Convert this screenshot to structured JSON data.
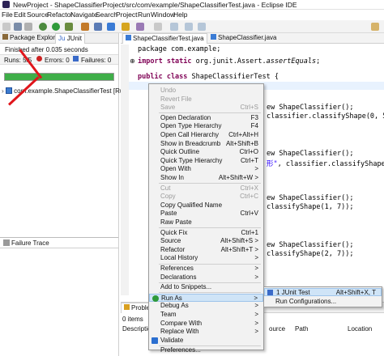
{
  "window": {
    "title": "NewProject - ShapeClassifierProject/src/com/example/ShapeClassifierTest.java - Eclipse IDE"
  },
  "menubar": [
    "File",
    "Edit",
    "Source",
    "Refactor",
    "Navigate",
    "Search",
    "Project",
    "Run",
    "Window",
    "Help"
  ],
  "left_tabs": {
    "package_explorer": "Package Explorer",
    "junit": "JUnit"
  },
  "junit": {
    "finished": "Finished after 0.035 seconds",
    "runs": "Runs: 5/5",
    "errors": "Errors: 0",
    "failures": "Failures: 0",
    "test_node": "com.example.ShapeClassifierTest [Runne",
    "bar_color": "#3fae49"
  },
  "failure_trace": {
    "label": "Failure Trace"
  },
  "editor": {
    "tabs": [
      "ShapeClassifierTest.java",
      "ShapeClassifier.java"
    ],
    "line1": "package com.example;",
    "line2_kw": "import static",
    "line2_rest": " org.junit.Assert.",
    "line2_it": "assertEquals",
    "line2_end": ";",
    "line3_kw": "public class",
    "line3_rest": " ShapeClassifierTest {",
    "frag1": "ew ShapeClassifier();",
    "frag2": "classifier.classifyShape(0, 5",
    "frag3": "ew ShapeClassifier();",
    "frag4_str": "形\"",
    "frag4_rest": ", classifier.classifyShape(",
    "frag5": "ew ShapeClassifier();",
    "frag6": "classifyShape(1, 7));",
    "frag7": "ew ShapeClassifier();",
    "frag8": "classifyShape(2, 7));",
    "frag9": "ource",
    "frag10": "Path",
    "frag11": "Location"
  },
  "context_menu": [
    {
      "label": "Undo",
      "shortcut": "",
      "disabled": true,
      "sep_after": false
    },
    {
      "label": "Revert File",
      "shortcut": "",
      "disabled": true,
      "sep_after": false
    },
    {
      "label": "Save",
      "shortcut": "Ctrl+S",
      "disabled": true,
      "sep_after": true
    },
    {
      "label": "Open Declaration",
      "shortcut": "F3",
      "disabled": false,
      "sep_after": false
    },
    {
      "label": "Open Type Hierarchy",
      "shortcut": "F4",
      "disabled": false,
      "sep_after": false
    },
    {
      "label": "Open Call Hierarchy",
      "shortcut": "Ctrl+Alt+H",
      "disabled": false,
      "sep_after": false
    },
    {
      "label": "Show in Breadcrumb",
      "shortcut": "Alt+Shift+B",
      "disabled": false,
      "sep_after": false
    },
    {
      "label": "Quick Outline",
      "shortcut": "Ctrl+O",
      "disabled": false,
      "sep_after": false
    },
    {
      "label": "Quick Type Hierarchy",
      "shortcut": "Ctrl+T",
      "disabled": false,
      "sep_after": false
    },
    {
      "label": "Open With",
      "shortcut": ">",
      "disabled": false,
      "sep_after": false
    },
    {
      "label": "Show In",
      "shortcut": "Alt+Shift+W >",
      "disabled": false,
      "sep_after": true
    },
    {
      "label": "Cut",
      "shortcut": "Ctrl+X",
      "disabled": true,
      "sep_after": false
    },
    {
      "label": "Copy",
      "shortcut": "Ctrl+C",
      "disabled": true,
      "sep_after": false
    },
    {
      "label": "Copy Qualified Name",
      "shortcut": "",
      "disabled": false,
      "sep_after": false
    },
    {
      "label": "Paste",
      "shortcut": "Ctrl+V",
      "disabled": false,
      "sep_after": false
    },
    {
      "label": "Raw Paste",
      "shortcut": "",
      "disabled": false,
      "sep_after": true
    },
    {
      "label": "Quick Fix",
      "shortcut": "Ctrl+1",
      "disabled": false,
      "sep_after": false
    },
    {
      "label": "Source",
      "shortcut": "Alt+Shift+S >",
      "disabled": false,
      "sep_after": false
    },
    {
      "label": "Refactor",
      "shortcut": "Alt+Shift+T >",
      "disabled": false,
      "sep_after": false
    },
    {
      "label": "Local History",
      "shortcut": ">",
      "disabled": false,
      "sep_after": true
    },
    {
      "label": "References",
      "shortcut": ">",
      "disabled": false,
      "sep_after": false
    },
    {
      "label": "Declarations",
      "shortcut": ">",
      "disabled": false,
      "sep_after": true
    },
    {
      "label": "Add to Snippets...",
      "shortcut": "",
      "disabled": false,
      "sep_after": true
    },
    {
      "label": "Run As",
      "shortcut": ">",
      "disabled": false,
      "sep_after": false,
      "highlight": true
    },
    {
      "label": "Debug As",
      "shortcut": ">",
      "disabled": false,
      "sep_after": false
    },
    {
      "label": "Team",
      "shortcut": ">",
      "disabled": false,
      "sep_after": false
    },
    {
      "label": "Compare With",
      "shortcut": ">",
      "disabled": false,
      "sep_after": false
    },
    {
      "label": "Replace With",
      "shortcut": ">",
      "disabled": false,
      "sep_after": false
    },
    {
      "label": "Validate",
      "shortcut": "",
      "disabled": false,
      "sep_after": true
    },
    {
      "label": "Preferences...",
      "shortcut": "",
      "disabled": false,
      "sep_after": false
    }
  ],
  "submenu": {
    "item1": "1 JUnit Test",
    "item1_sc": "Alt+Shift+X, T",
    "item2": "Run Configurations..."
  },
  "bottom": {
    "tab": "Probler",
    "items": "0 items",
    "col1": "Description"
  }
}
